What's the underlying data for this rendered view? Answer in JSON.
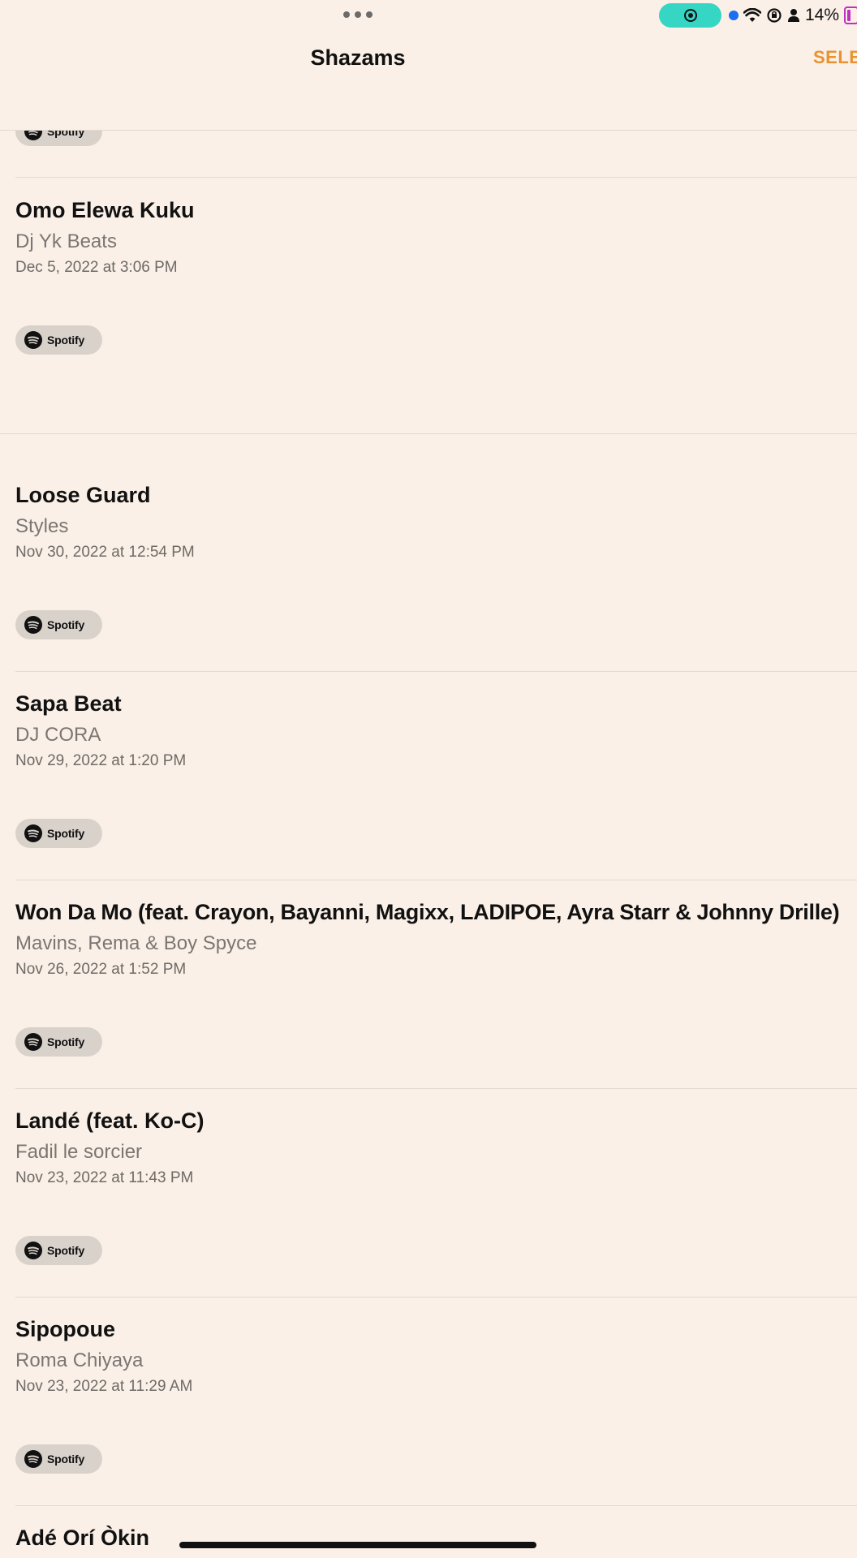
{
  "status_bar": {
    "battery_text": "14%",
    "recording_color": "#35d6c3",
    "icons": [
      "multitask-dots-icon",
      "screen-record-icon",
      "location-dot-icon",
      "wifi-icon",
      "rotation-lock-icon",
      "person-icon",
      "battery-icon"
    ]
  },
  "nav": {
    "title": "Shazams",
    "select_label": "SELECT",
    "accent_color": "#e8932f"
  },
  "spotify_label": "Spotify",
  "songs": [
    {
      "title": "Omo Elewa Kuku",
      "artist": "Dj Yk Beats",
      "date": "Dec 5, 2022 at 3:06 PM"
    },
    {
      "title": "Loose Guard",
      "artist": "Styles",
      "date": "Nov 30, 2022 at 12:54 PM"
    },
    {
      "title": "Sapa Beat",
      "artist": "DJ CORA",
      "date": "Nov 29, 2022 at 1:20 PM"
    },
    {
      "title": "Won Da Mo (feat. Crayon, Bayanni, Magixx, LADIPOE, Ayra Starr & Johnny Drille)",
      "artist": "Mavins, Rema & Boy Spyce",
      "date": "Nov 26, 2022 at 1:52 PM"
    },
    {
      "title": "Landé (feat. Ko-C)",
      "artist": "Fadil le sorcier",
      "date": "Nov 23, 2022 at 11:43 PM"
    },
    {
      "title": "Sipopoue",
      "artist": "Roma Chiyaya",
      "date": "Nov 23, 2022 at 11:29 AM"
    },
    {
      "title": "Adé Orí Òkin"
    }
  ]
}
